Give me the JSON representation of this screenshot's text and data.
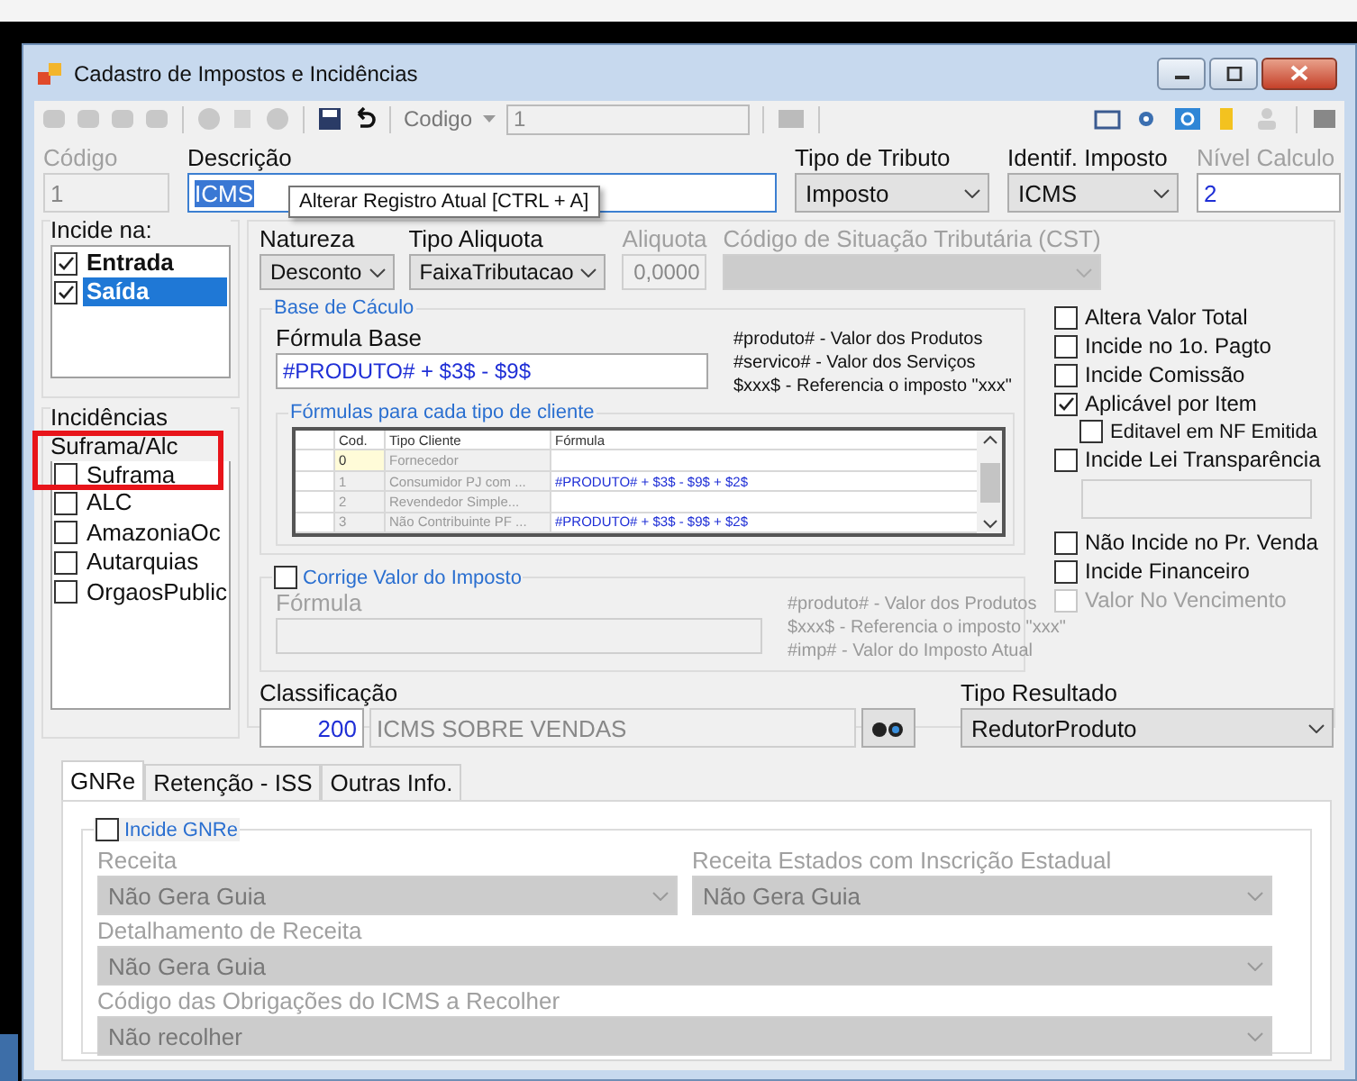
{
  "window": {
    "title": "Cadastro de Impostos e Incidências"
  },
  "toolbar": {
    "codigo_label": "Codigo",
    "codigo_value": "1"
  },
  "header_fields": [
    {
      "label": "Código",
      "value": "1",
      "kind": "text",
      "dim": true,
      "disabled": true
    },
    {
      "label": "Descrição",
      "value": "ICMS",
      "kind": "text",
      "dim": false,
      "disabled": false,
      "selected": true
    },
    {
      "label": "Tipo de Tributo",
      "value": "Imposto",
      "kind": "select",
      "dim": false
    },
    {
      "label": "Identif. Imposto",
      "value": "ICMS",
      "kind": "select",
      "dim": false
    },
    {
      "label": "Nível Calculo",
      "value": "2",
      "kind": "text",
      "dim": true,
      "disabled": false
    }
  ],
  "tooltip": "Alterar Registro Atual [CTRL + A]",
  "incide_na": {
    "title": "Incide na:",
    "items": [
      {
        "label": "Entrada",
        "checked": true,
        "selected": false
      },
      {
        "label": "Saída",
        "checked": true,
        "selected": true
      }
    ]
  },
  "suframa": {
    "title": "Incidências Suframa/Alc",
    "items": [
      {
        "label": "Suframa",
        "checked": false
      },
      {
        "label": "ALC",
        "checked": false
      },
      {
        "label": "AmazoniaOc",
        "checked": false
      },
      {
        "label": "Autarquias",
        "checked": false
      },
      {
        "label": "OrgaosPublic",
        "checked": false
      }
    ]
  },
  "top_fields": [
    {
      "label": "Natureza",
      "value": "Desconto",
      "kind": "select",
      "disabled": false
    },
    {
      "label": "Tipo Aliquota",
      "value": "FaixaTributacao",
      "kind": "select",
      "disabled": false
    },
    {
      "label": "Aliquota",
      "value": "0,0000",
      "kind": "text",
      "disabled": true
    },
    {
      "label": "Código de Situação Tributária (CST)",
      "kind": "select",
      "disabled": true
    }
  ],
  "base_calculo": {
    "title": "Base de Cáculo",
    "formula_label": "Fórmula Base",
    "formula": "#PRODUTO# + $3$ - $9$",
    "hints": [
      "#produto# - Valor dos Produtos",
      "#servico# - Valor dos Serviços",
      "$xxx$ - Referencia o imposto \"xxx\""
    ]
  },
  "client_formulas": {
    "title": "Fórmulas para cada tipo de cliente",
    "columns": [
      "Cod.",
      "Tipo Cliente",
      "Fórmula"
    ],
    "rows": [
      {
        "cod": "0",
        "tipo": "Fornecedor",
        "selected": true
      },
      {
        "cod": "1",
        "tipo": "Consumidor PJ com ...",
        "formula": "#PRODUTO# + $3$ - $9$ + $2$",
        "selected": false
      },
      {
        "cod": "2",
        "tipo": "Revendedor Simple...",
        "selected": false
      },
      {
        "cod": "3",
        "tipo": "Não Contribuinte PF ...",
        "formula": "#PRODUTO# + $3$ - $9$ + $2$",
        "selected": false
      }
    ]
  },
  "options": [
    {
      "kind": "checkbox",
      "label": "Altera Valor Total",
      "checked": false,
      "disabled": false
    },
    {
      "kind": "checkbox",
      "label": "Incide no 1o. Pagto",
      "checked": false,
      "disabled": false
    },
    {
      "kind": "checkbox",
      "label": "Incide Comissão",
      "checked": false,
      "disabled": false
    },
    {
      "kind": "checkbox",
      "label": "Aplicável por Item",
      "checked": true,
      "disabled": false,
      "children": [
        {
          "kind": "checkbox",
          "label": "Editavel em NF Emitida",
          "checked": false,
          "disabled": false
        }
      ]
    },
    {
      "kind": "checkbox",
      "label": "Incide Lei Transparência",
      "checked": false,
      "disabled": false
    },
    {
      "kind": "field",
      "disabled": true
    },
    {
      "kind": "checkbox",
      "label": "Não Incide no Pr. Venda",
      "checked": false,
      "disabled": false
    },
    {
      "kind": "checkbox",
      "label": "Incide Financeiro",
      "checked": false,
      "disabled": false
    },
    {
      "kind": "checkbox",
      "label": "Valor No Vencimento",
      "checked": false,
      "disabled": true
    }
  ],
  "corrige": {
    "label": "Corrige Valor do Imposto",
    "checked": false,
    "formula_label": "Fórmula",
    "hints": [
      "#produto# - Valor dos Produtos",
      "$xxx$ - Referencia o imposto \"xxx\"",
      "#imp# - Valor do Imposto Atual"
    ]
  },
  "classificacao": {
    "label": "Classificação",
    "code": "200",
    "description": "ICMS SOBRE VENDAS"
  },
  "tipo_resultado": {
    "label": "Tipo Resultado",
    "value": "RedutorProduto"
  },
  "tabs": [
    {
      "label": "GNRe",
      "selected": true
    },
    {
      "label": "Retenção - ISS",
      "selected": false
    },
    {
      "label": "Outras Info.",
      "selected": false
    }
  ],
  "gnre": {
    "label": "Incide GNRe",
    "checked": false,
    "fields": [
      {
        "label": "Receita",
        "value": "Não Gera Guia"
      },
      {
        "label": "Receita Estados com Inscrição Estadual",
        "value": "Não Gera Guia"
      },
      {
        "label": "Detalhamento de Receita",
        "value": "Não Gera Guia"
      },
      {
        "label": "Código das Obrigações do ICMS a Recolher",
        "value": "Não recolher"
      }
    ]
  }
}
